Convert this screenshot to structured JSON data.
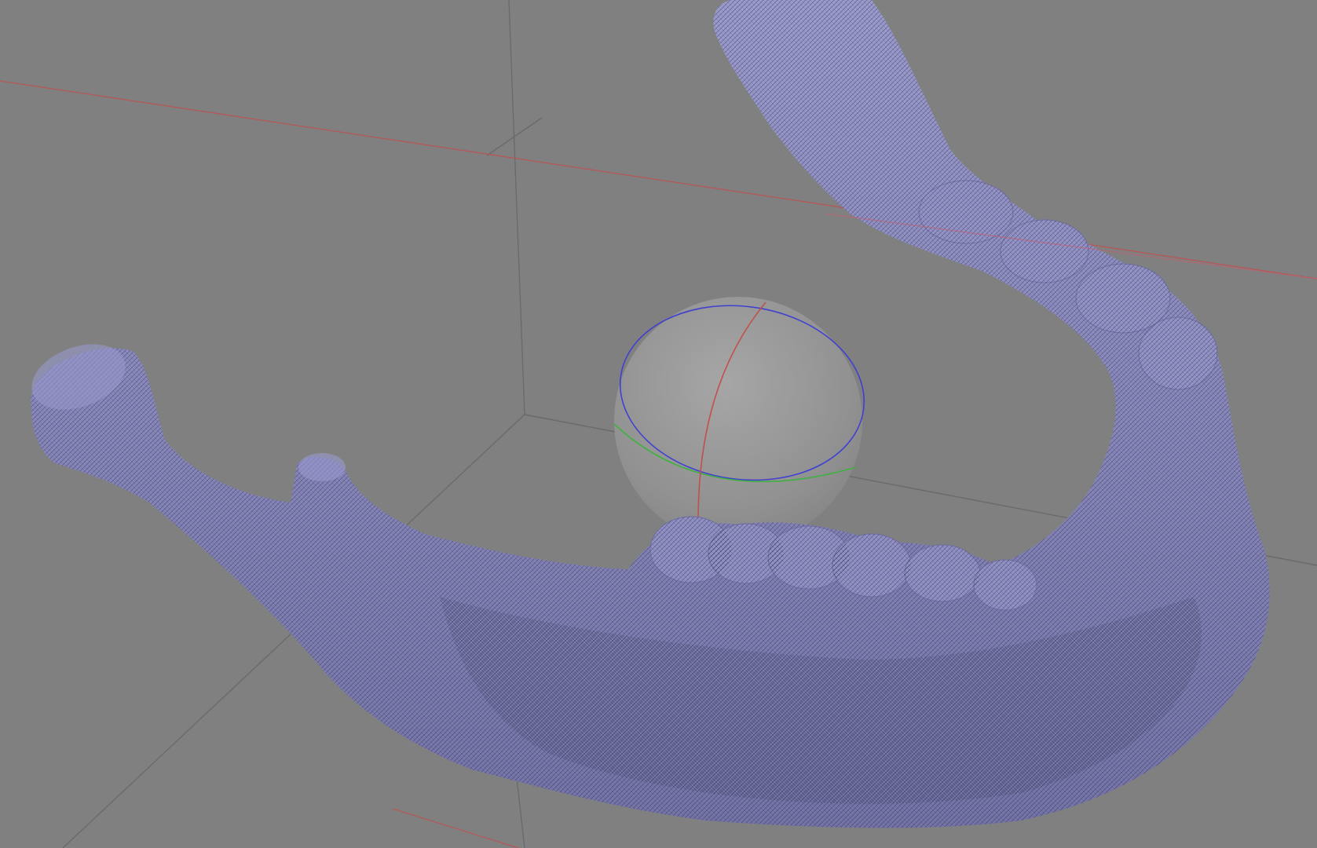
{
  "viewport": {
    "background_color": "#808080",
    "mesh_color": "#8c8cc0",
    "wire_color": "#1c1c30",
    "grid_color": "#6a6a6a",
    "axis_x_color": "#c05050",
    "axis_y_color": "#40b040",
    "axis_z_color": "#4040d0",
    "trackball_color": "#9a9a9a"
  },
  "scene": {
    "model": "mandible-mesh",
    "shading": "wireframe-over-flat",
    "trackball_visible": true,
    "bounding_box_visible": true
  }
}
